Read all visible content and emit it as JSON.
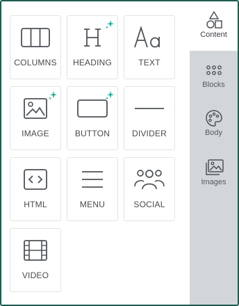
{
  "colors": {
    "frame_border": "#1d5c4f",
    "ai_sparkle": "#2bb3a0",
    "icon_stroke": "#4d5257"
  },
  "blocks": [
    {
      "label": "COLUMNS",
      "icon": "columns-icon",
      "ai": false
    },
    {
      "label": "HEADING",
      "icon": "heading-icon",
      "ai": true
    },
    {
      "label": "TEXT",
      "icon": "text-icon",
      "ai": false
    },
    {
      "label": "IMAGE",
      "icon": "image-icon",
      "ai": true
    },
    {
      "label": "BUTTON",
      "icon": "button-icon",
      "ai": true
    },
    {
      "label": "DIVIDER",
      "icon": "divider-icon",
      "ai": false
    },
    {
      "label": "HTML",
      "icon": "html-code-icon",
      "ai": false
    },
    {
      "label": "MENU",
      "icon": "menu-icon",
      "ai": false
    },
    {
      "label": "SOCIAL",
      "icon": "social-users-icon",
      "ai": false
    },
    {
      "label": "VIDEO",
      "icon": "video-film-icon",
      "ai": false
    }
  ],
  "tabs": [
    {
      "label": "Content",
      "icon": "shapes-icon",
      "active": true
    },
    {
      "label": "Blocks",
      "icon": "grid-dots-icon",
      "active": false
    },
    {
      "label": "Body",
      "icon": "palette-icon",
      "active": false
    },
    {
      "label": "Images",
      "icon": "images-icon",
      "active": false
    }
  ]
}
